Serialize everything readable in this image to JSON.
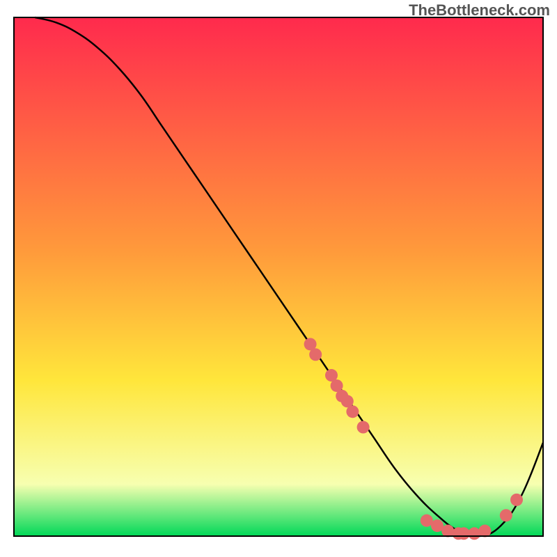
{
  "watermark": "TheBottleneck.com",
  "chart_data": {
    "type": "line",
    "title": "",
    "xlabel": "",
    "ylabel": "",
    "xlim": [
      0,
      100
    ],
    "ylim": [
      0,
      100
    ],
    "grid": false,
    "legend": false,
    "gradient_background": {
      "top_color": "#ff2a4d",
      "mid_color": "#ffe63b",
      "bottom_color": "#00d858"
    },
    "series": [
      {
        "name": "bottleneck-curve",
        "stroke": "#000000",
        "x": [
          4,
          8,
          12,
          16,
          20,
          24,
          28,
          32,
          36,
          40,
          44,
          48,
          52,
          56,
          60,
          64,
          68,
          72,
          76,
          80,
          84,
          88,
          92,
          96,
          100
        ],
        "y": [
          100,
          99,
          97,
          94,
          90,
          85,
          79,
          73,
          67,
          61,
          55,
          49,
          43,
          37,
          31,
          25,
          19,
          13,
          8,
          4,
          1,
          0,
          2,
          8,
          18
        ]
      }
    ],
    "dot_clusters": {
      "color": "#e46a6a",
      "radius": 9,
      "clusters": [
        {
          "name": "upper-cluster",
          "points": [
            {
              "x": 56,
              "y": 37
            },
            {
              "x": 57,
              "y": 35
            },
            {
              "x": 60,
              "y": 31
            },
            {
              "x": 61,
              "y": 29
            },
            {
              "x": 62,
              "y": 27
            },
            {
              "x": 63,
              "y": 26
            },
            {
              "x": 64,
              "y": 24
            },
            {
              "x": 66,
              "y": 21
            }
          ]
        },
        {
          "name": "lower-cluster",
          "points": [
            {
              "x": 78,
              "y": 3
            },
            {
              "x": 80,
              "y": 2
            },
            {
              "x": 82,
              "y": 1
            },
            {
              "x": 84,
              "y": 0.5
            },
            {
              "x": 85,
              "y": 0.5
            },
            {
              "x": 87,
              "y": 0.5
            },
            {
              "x": 89,
              "y": 1
            }
          ]
        },
        {
          "name": "rise-cluster",
          "points": [
            {
              "x": 93,
              "y": 4
            },
            {
              "x": 95,
              "y": 7
            }
          ]
        }
      ]
    },
    "plot_frame": {
      "stroke": "#000000",
      "stroke_width": 2
    }
  }
}
